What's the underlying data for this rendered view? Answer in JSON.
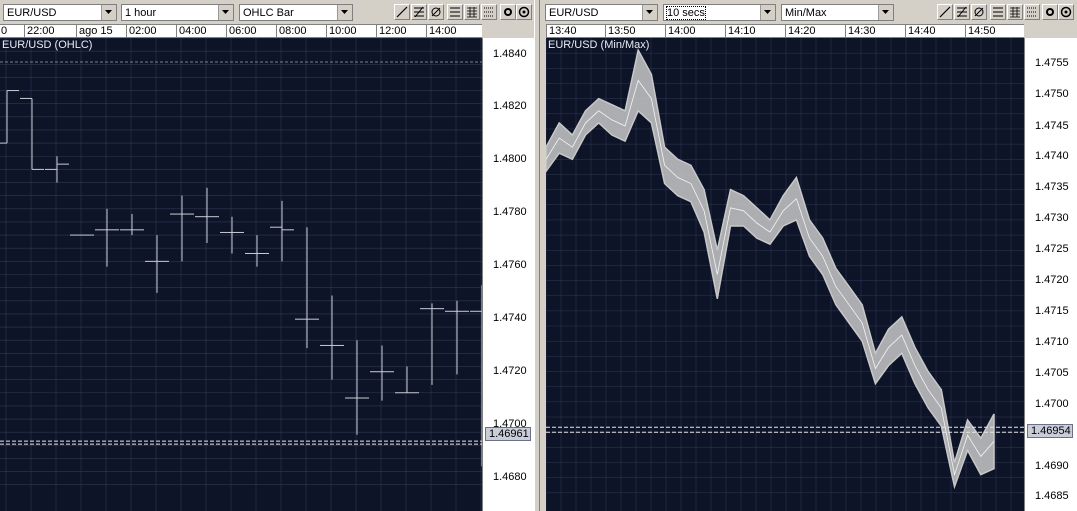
{
  "left_panel": {
    "symbol": "EUR/USD",
    "interval": "1 hour",
    "chart_type": "OHLC Bar",
    "caption": "EUR/USD (OHLC)",
    "time_labels": [
      "0",
      "22:00",
      "ago 15",
      "02:00",
      "04:00",
      "06:00",
      "08:00",
      "10:00",
      "12:00",
      "14:00"
    ],
    "price_labels": [
      "1.4840",
      "1.4820",
      "1.4800",
      "1.4780",
      "1.4760",
      "1.4740",
      "1.4720",
      "1.4700",
      "1.4680"
    ],
    "last_price": "1.46961",
    "colors": {
      "background": "#0e1428",
      "grid": "#2e3852",
      "bars": "#c8ccd6",
      "dashed": "#e6e6e6"
    }
  },
  "right_panel": {
    "symbol": "EUR/USD",
    "interval": "10 secs",
    "chart_type": "Min/Max",
    "caption": "EUR/USD (Min/Max)",
    "time_labels": [
      "13:40",
      "13:50",
      "14:00",
      "14:10",
      "14:20",
      "14:30",
      "14:40",
      "14:50"
    ],
    "price_labels": [
      "1.4755",
      "1.4750",
      "1.4745",
      "1.4740",
      "1.4735",
      "1.4730",
      "1.4725",
      "1.4720",
      "1.4715",
      "1.4710",
      "1.4705",
      "1.4700",
      "1.4695",
      "1.4690",
      "1.4685"
    ],
    "last_price": "1.46954",
    "colors": {
      "background": "#0e1428",
      "grid": "#2e3852",
      "band": "#c8c8c8",
      "dashed": "#e6e6e6"
    }
  },
  "toolbar_icons": [
    "trendline-icon",
    "fibonacci-icon",
    "no-draw-icon",
    "grid-icon",
    "grid-fine-icon",
    "grid-dots-icon",
    "zoom-icon",
    "settings-icon"
  ],
  "chart_data": [
    {
      "type": "ohlc",
      "title": "EUR/USD (OHLC)",
      "interval": "1 hour",
      "ylim": [
        1.467,
        1.485
      ],
      "grid": true,
      "bars": [
        {
          "o": 1.481,
          "h": 1.483,
          "l": 1.481,
          "c": 1.483
        },
        {
          "o": 1.4827,
          "h": 1.4827,
          "l": 1.48,
          "c": 1.48
        },
        {
          "o": 1.48,
          "h": 1.4805,
          "l": 1.4795,
          "c": 1.4802
        },
        {
          "o": 1.4775,
          "h": 1.4775,
          "l": 1.4775,
          "c": 1.4775
        },
        {
          "o": 1.4777,
          "h": 1.4785,
          "l": 1.4763,
          "c": 1.4777
        },
        {
          "o": 1.4777,
          "h": 1.4783,
          "l": 1.4775,
          "c": 1.4777
        },
        {
          "o": 1.4765,
          "h": 1.4775,
          "l": 1.4753,
          "c": 1.4765
        },
        {
          "o": 1.4783,
          "h": 1.479,
          "l": 1.4765,
          "c": 1.4783
        },
        {
          "o": 1.4782,
          "h": 1.4793,
          "l": 1.4772,
          "c": 1.4782
        },
        {
          "o": 1.4776,
          "h": 1.4782,
          "l": 1.4768,
          "c": 1.4776
        },
        {
          "o": 1.4768,
          "h": 1.4775,
          "l": 1.4763,
          "c": 1.4768
        },
        {
          "o": 1.4778,
          "h": 1.4788,
          "l": 1.4765,
          "c": 1.4777
        },
        {
          "o": 1.4743,
          "h": 1.4778,
          "l": 1.4732,
          "c": 1.4743
        },
        {
          "o": 1.4733,
          "h": 1.4752,
          "l": 1.472,
          "c": 1.4733
        },
        {
          "o": 1.4713,
          "h": 1.4735,
          "l": 1.4699,
          "c": 1.4713
        },
        {
          "o": 1.4723,
          "h": 1.4733,
          "l": 1.4712,
          "c": 1.4723
        },
        {
          "o": 1.4715,
          "h": 1.4725,
          "l": 1.4715,
          "c": 1.4715
        },
        {
          "o": 1.4747,
          "h": 1.4749,
          "l": 1.4718,
          "c": 1.4747
        },
        {
          "o": 1.4746,
          "h": 1.475,
          "l": 1.4722,
          "c": 1.4746
        },
        {
          "o": 1.4746,
          "h": 1.4756,
          "l": 1.4687,
          "c": 1.4696
        }
      ]
    },
    {
      "type": "area",
      "title": "EUR/USD (Min/Max)",
      "interval": "10 secs",
      "ylim": [
        1.4682,
        1.476
      ],
      "grid": true,
      "x": [
        "13:40",
        "13:43",
        "13:46",
        "13:49",
        "13:52",
        "13:55",
        "13:58",
        "14:00",
        "14:02",
        "14:04",
        "14:06",
        "14:08",
        "14:10",
        "14:12",
        "14:14",
        "14:16",
        "14:18",
        "14:20",
        "14:22",
        "14:24",
        "14:26",
        "14:28",
        "14:30",
        "14:32",
        "14:34",
        "14:36",
        "14:38",
        "14:40",
        "14:42",
        "14:44",
        "14:46",
        "14:48",
        "14:50",
        "14:52",
        "14:54"
      ],
      "series": [
        {
          "name": "Max",
          "values": [
            1.4742,
            1.4746,
            1.4744,
            1.4748,
            1.475,
            1.4749,
            1.4748,
            1.4758,
            1.4754,
            1.4742,
            1.474,
            1.4739,
            1.4735,
            1.4725,
            1.4735,
            1.4734,
            1.4732,
            1.473,
            1.4734,
            1.4737,
            1.473,
            1.4727,
            1.4722,
            1.4719,
            1.4716,
            1.4708,
            1.4712,
            1.4714,
            1.4709,
            1.4705,
            1.4702,
            1.469,
            1.4697,
            1.4694,
            1.4698
          ]
        },
        {
          "name": "Min",
          "values": [
            1.4738,
            1.4741,
            1.474,
            1.4744,
            1.4746,
            1.4744,
            1.4743,
            1.4748,
            1.4746,
            1.4736,
            1.4734,
            1.4733,
            1.4728,
            1.4717,
            1.4729,
            1.4729,
            1.4727,
            1.4726,
            1.4729,
            1.473,
            1.4724,
            1.4721,
            1.4716,
            1.4713,
            1.471,
            1.4703,
            1.4706,
            1.4708,
            1.4703,
            1.4699,
            1.4696,
            1.4686,
            1.4692,
            1.4688,
            1.4689
          ]
        }
      ]
    }
  ]
}
